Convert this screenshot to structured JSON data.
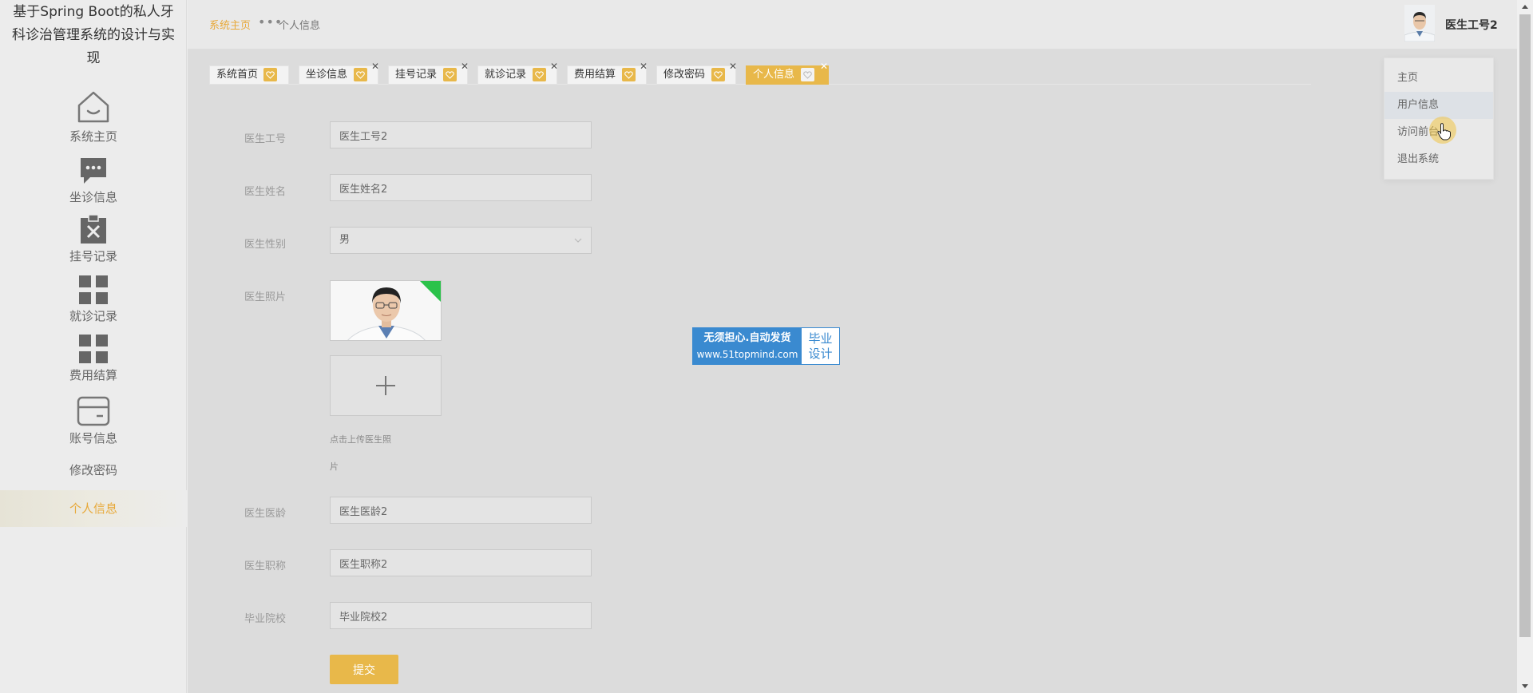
{
  "app": {
    "title": "基于Spring Boot的私人牙科诊治管理系统的设计与实现"
  },
  "sidebar": {
    "items": [
      {
        "label": "系统主页",
        "icon": "home-icon"
      },
      {
        "label": "坐诊信息",
        "icon": "chat-icon"
      },
      {
        "label": "挂号记录",
        "icon": "clipboard-x-icon"
      },
      {
        "label": "就诊记录",
        "icon": "grid-icon"
      },
      {
        "label": "费用结算",
        "icon": "grid-icon"
      },
      {
        "label": "账号信息",
        "icon": "card-icon"
      },
      {
        "label": "修改密码"
      },
      {
        "label": "个人信息"
      }
    ],
    "active_index": 7
  },
  "header": {
    "breadcrumb": {
      "home": "系统主页",
      "separator": "•••",
      "current": "个人信息"
    },
    "user_name": "医生工号2"
  },
  "tabs": [
    {
      "label": "系统首页",
      "closable": false
    },
    {
      "label": "坐诊信息",
      "closable": true
    },
    {
      "label": "挂号记录",
      "closable": true
    },
    {
      "label": "就诊记录",
      "closable": true
    },
    {
      "label": "费用结算",
      "closable": true
    },
    {
      "label": "修改密码",
      "closable": true
    },
    {
      "label": "个人信息",
      "closable": true,
      "active": true
    }
  ],
  "form": {
    "doctor_id": {
      "label": "医生工号",
      "value": "医生工号2"
    },
    "doctor_name": {
      "label": "医生姓名",
      "value": "医生姓名2"
    },
    "doctor_gender": {
      "label": "医生性别",
      "value": "男"
    },
    "doctor_photo": {
      "label": "医生照片",
      "upload_hint_line1": "点击上传医生照",
      "upload_hint_line2": "片"
    },
    "doctor_seniority": {
      "label": "医生医龄",
      "value": "医生医龄2"
    },
    "doctor_title": {
      "label": "医生职称",
      "value": "医生职称2"
    },
    "graduate_school": {
      "label": "毕业院校",
      "value": "毕业院校2"
    },
    "submit_label": "提交"
  },
  "watermark": {
    "line1": "无须担心.自动发货",
    "line2": "www.51topmind.com",
    "right_line1": "毕业",
    "right_line2": "设计"
  },
  "user_menu": {
    "items": [
      {
        "label": "主页"
      },
      {
        "label": "用户信息"
      },
      {
        "label": "访问前台"
      },
      {
        "label": "退出系统"
      }
    ],
    "hover_index": 1
  },
  "colors": {
    "accent": "#e8b84a",
    "accent_text": "#e8a93a",
    "sidebar_bg": "#ececec",
    "main_bg": "#dcdcdc",
    "watermark_blue": "#3a8ad0"
  }
}
